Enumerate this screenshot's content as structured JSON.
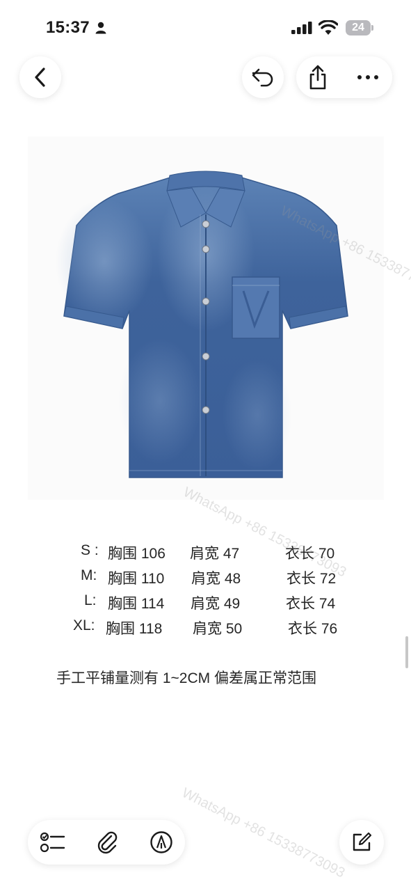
{
  "status_bar": {
    "time": "15:37",
    "battery": "24"
  },
  "toolbar_top": {
    "back_icon": "chevron-left-icon",
    "undo_icon": "undo-icon",
    "share_icon": "share-icon",
    "more_icon": "more-icon"
  },
  "size_chart": [
    {
      "size": "S :",
      "chest": "胸围 106",
      "shoulder": "肩宽 47",
      "length": "衣长 70"
    },
    {
      "size": "M:",
      "chest": "胸围 110",
      "shoulder": "肩宽 48",
      "length": "衣长 72"
    },
    {
      "size": "L:",
      "chest": "胸围 114",
      "shoulder": "肩宽 49",
      "length": "衣长 74"
    },
    {
      "size": "XL:",
      "chest": "胸围 118",
      "shoulder": "肩宽 50",
      "length": "衣长 76"
    }
  ],
  "note": "手工平铺量测有 1~2CM 偏差属正常范围",
  "watermark": "WhatsApp +86 15338773093",
  "toolbar_bottom": {
    "checklist_icon": "checklist-icon",
    "attachment_icon": "paperclip-icon",
    "markup_icon": "markup-pen-icon",
    "compose_icon": "compose-icon"
  },
  "colors": {
    "denim": "#3f67a0",
    "denim_light": "#7c9cc7",
    "background": "#ffffff"
  }
}
